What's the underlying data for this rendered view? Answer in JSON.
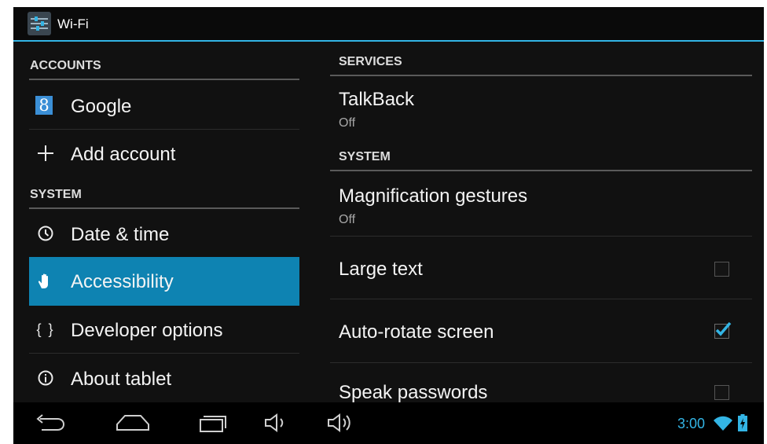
{
  "actionbar": {
    "title": "Wi-Fi",
    "icon": "settings-sliders-icon"
  },
  "left": {
    "accounts_header": "ACCOUNTS",
    "accounts": [
      {
        "label": "Google",
        "icon": "google-icon"
      },
      {
        "label": "Add account",
        "icon": "plus-icon"
      }
    ],
    "system_header": "SYSTEM",
    "system": [
      {
        "label": "Date & time",
        "icon": "clock-icon"
      },
      {
        "label": "Accessibility",
        "icon": "hand-icon",
        "selected": true
      },
      {
        "label": "Developer options",
        "icon": "braces-icon"
      },
      {
        "label": "About tablet",
        "icon": "info-icon"
      }
    ]
  },
  "right": {
    "services_header": "SERVICES",
    "talkback": {
      "title": "TalkBack",
      "summary": "Off"
    },
    "system_header": "SYSTEM",
    "magnification": {
      "title": "Magnification gestures",
      "summary": "Off"
    },
    "large_text": {
      "title": "Large text",
      "checked": false
    },
    "auto_rotate": {
      "title": "Auto-rotate screen",
      "checked": true
    },
    "speak_passwords": {
      "title": "Speak passwords",
      "checked": false
    }
  },
  "navbar": {
    "clock": "3:00",
    "buttons": [
      "back-icon",
      "home-icon",
      "recent-apps-icon",
      "volume-down-icon",
      "volume-up-icon"
    ]
  },
  "colors": {
    "accent": "#33b5e5",
    "selected": "#0e83b2",
    "background": "#111111"
  }
}
